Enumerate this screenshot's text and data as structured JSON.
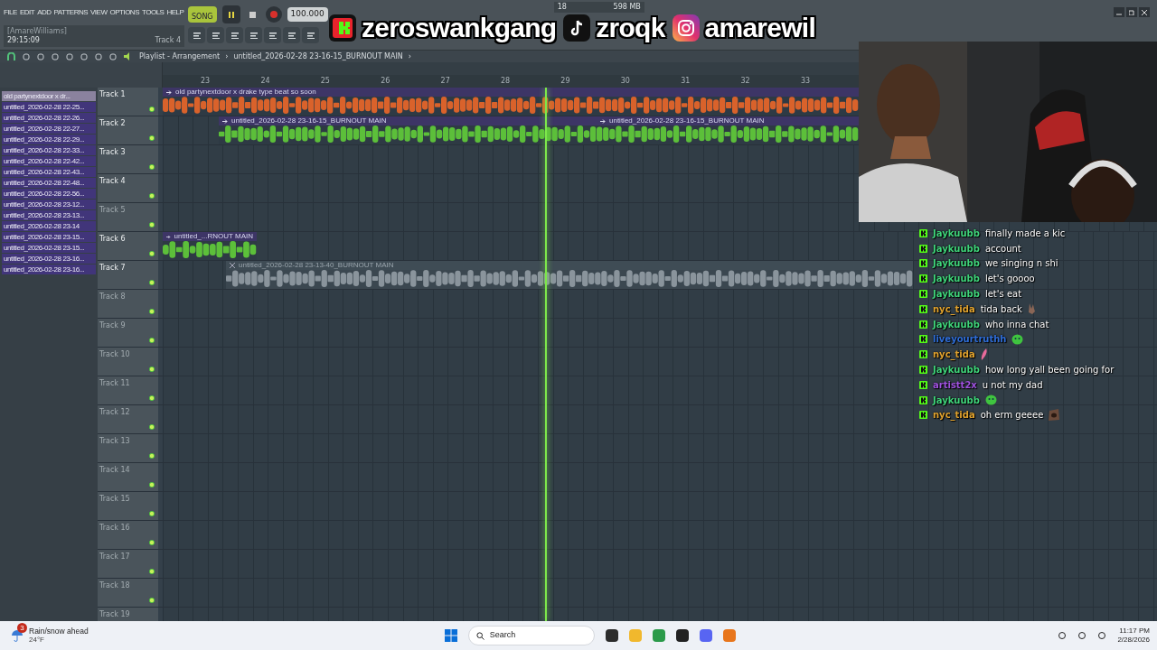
{
  "menu": [
    "FILE",
    "EDIT",
    "ADD",
    "PATTERNS",
    "VIEW",
    "OPTIONS",
    "TOOLS",
    "HELP"
  ],
  "transport": {
    "mode": "SONG",
    "mode_on": true,
    "playing": true,
    "tempo": "100.000"
  },
  "hint": {
    "user": "[AmareWilliams]",
    "time": "29:15:09",
    "target": "Track 4"
  },
  "monitor": {
    "cpu": "18",
    "memory": "598 MB"
  },
  "socials": [
    {
      "kind": "kick",
      "handle": "zeroswankgang"
    },
    {
      "kind": "tiktok",
      "handle": "zroqk"
    },
    {
      "kind": "instagram",
      "handle": "amarewil"
    }
  ],
  "playlist": {
    "path": [
      "Playlist - Arrangement",
      "›",
      "untitled_2026-02-28 23-16-15_BURNOUT MAIN",
      "›"
    ]
  },
  "ruler": [
    "23",
    "24",
    "25",
    "26",
    "27",
    "28",
    "29",
    "30",
    "31",
    "32",
    "33"
  ],
  "patterns": [
    {
      "label": "old partynextdoor x dr...",
      "selected": true
    },
    {
      "label": "untitled_2026-02-28 22-25...",
      "selected": false
    },
    {
      "label": "untitled_2026-02-28 22-26...",
      "selected": false
    },
    {
      "label": "untitled_2026-02-28 22-27...",
      "selected": false
    },
    {
      "label": "untitled_2026-02-28 22-29...",
      "selected": false
    },
    {
      "label": "untitled_2026-02-28 22-33...",
      "selected": false
    },
    {
      "label": "untitled_2026-02-28 22-42...",
      "selected": false
    },
    {
      "label": "untitled_2026-02-28 22-43...",
      "selected": false
    },
    {
      "label": "untitled_2026-02-28 22-48...",
      "selected": false
    },
    {
      "label": "untitled_2026-02-28 22-56...",
      "selected": false
    },
    {
      "label": "untitled_2026-02-28 23-12...",
      "selected": false
    },
    {
      "label": "untitled_2026-02-28 23-13...",
      "selected": false
    },
    {
      "label": "untitled_2026-02-28 23-14",
      "selected": false
    },
    {
      "label": "untitled_2026-02-28 23-15...",
      "selected": false
    },
    {
      "label": "untitled_2026-02-28 23-15...",
      "selected": false
    },
    {
      "label": "untitled_2026-02-28 23-16...",
      "selected": false
    },
    {
      "label": "untitled_2026-02-28 23-16...",
      "selected": false
    }
  ],
  "tracks": [
    {
      "name": "Track 1",
      "active": true,
      "clips": [
        {
          "label": "old partynextdoor x drake type beat so soon",
          "color": "#d9622b",
          "muted": false
        }
      ]
    },
    {
      "name": "Track 2",
      "active": true,
      "clips": [
        {
          "label": "untitled_2026-02-28 23-16-15_BURNOUT MAIN",
          "color": "#5cbf3a",
          "muted": false
        },
        {
          "label": "untitled_2026-02-28 23-16-15_BURNOUT MAIN",
          "color": "#5cbf3a",
          "muted": false
        }
      ]
    },
    {
      "name": "Track 3",
      "active": true
    },
    {
      "name": "Track 4",
      "active": true
    },
    {
      "name": "Track 5",
      "active": false
    },
    {
      "name": "Track 6",
      "active": true,
      "clips": [
        {
          "label": "untitled_...RNOUT MAIN",
          "color": "#5cbf3a",
          "muted": false
        }
      ]
    },
    {
      "name": "Track 7",
      "active": true,
      "clips": [
        {
          "label": "untitled_2026-02-28 23-13-40_BURNOUT MAIN",
          "color": "#8a949c",
          "muted": true
        }
      ]
    },
    {
      "name": "Track 8",
      "active": false
    },
    {
      "name": "Track 9",
      "active": false
    },
    {
      "name": "Track 10",
      "active": false
    },
    {
      "name": "Track 11",
      "active": false
    },
    {
      "name": "Track 12",
      "active": false
    },
    {
      "name": "Track 13",
      "active": false
    },
    {
      "name": "Track 14",
      "active": false
    },
    {
      "name": "Track 15",
      "active": false
    },
    {
      "name": "Track 16",
      "active": false
    },
    {
      "name": "Track 17",
      "active": false
    },
    {
      "name": "Track 18",
      "active": false
    },
    {
      "name": "Track 19",
      "active": false
    }
  ],
  "chat": [
    {
      "kind": "text",
      "user": "Jaykuubb",
      "color": "#3fd47a",
      "text": "finally made a kic"
    },
    {
      "kind": "text",
      "user": "Jaykuubb",
      "color": "#3fd47a",
      "text": "account"
    },
    {
      "kind": "text",
      "user": "Jaykuubb",
      "color": "#3fd47a",
      "text": "we singing n shi"
    },
    {
      "kind": "text",
      "user": "Jaykuubb",
      "color": "#3fd47a",
      "text": "let's goooo"
    },
    {
      "kind": "text",
      "user": "Jaykuubb",
      "color": "#3fd47a",
      "text": "let's eat"
    },
    {
      "kind": "peace",
      "user": "nyc_tida",
      "color": "#e0a22e",
      "text": "tida back"
    },
    {
      "kind": "text",
      "user": "Jaykuubb",
      "color": "#3fd47a",
      "text": "who inna chat"
    },
    {
      "kind": "blob",
      "user": "liveyourtruthh",
      "color": "#2f6ed8"
    },
    {
      "kind": "feather",
      "user": "nyc_tida",
      "color": "#e0a22e"
    },
    {
      "kind": "text",
      "user": "Jaykuubb",
      "color": "#3fd47a",
      "text": "how long yall been going for"
    },
    {
      "kind": "text",
      "user": "artistt2x",
      "color": "#a052e0",
      "text": "u not my dad"
    },
    {
      "kind": "blob",
      "user": "Jaykuubb",
      "color": "#3fd47a"
    },
    {
      "kind": "face",
      "user": "nyc_tida",
      "color": "#e0a22e",
      "text": "oh erm geeee"
    }
  ],
  "taskbar": {
    "weather": "Rain/snow ahead",
    "temperature": "24°F",
    "alerts": "3",
    "search": "Search",
    "time": "11:17 PM",
    "date": "2/28/2026"
  }
}
